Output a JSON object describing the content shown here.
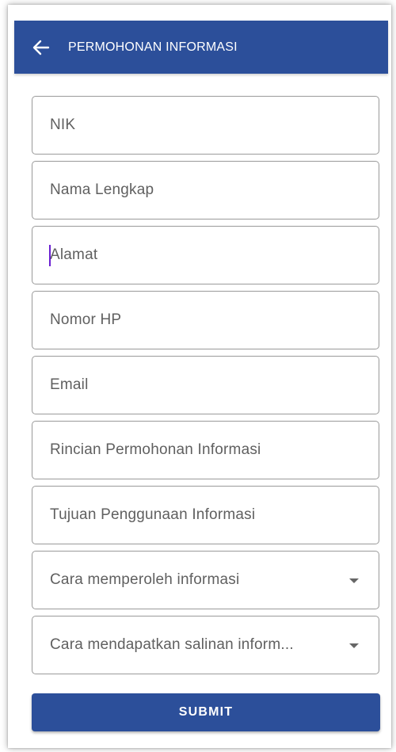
{
  "header": {
    "title": "PERMOHONAN INFORMASI",
    "back_icon": "arrow-left-icon",
    "color": "#2c4f9a"
  },
  "form": {
    "nik": {
      "placeholder": "NIK",
      "value": ""
    },
    "nama": {
      "placeholder": "Nama Lengkap",
      "value": ""
    },
    "alamat": {
      "placeholder": "Alamat",
      "value": ""
    },
    "nomor_hp": {
      "placeholder": "Nomor HP",
      "value": ""
    },
    "email": {
      "placeholder": "Email",
      "value": ""
    },
    "rincian": {
      "placeholder": "Rincian Permohonan Informasi",
      "value": ""
    },
    "tujuan": {
      "placeholder": "Tujuan Penggunaan Informasi",
      "value": ""
    },
    "cara_memperoleh": {
      "label": "Cara memperoleh informasi"
    },
    "cara_salinan": {
      "label": "Cara mendapatkan salinan inform..."
    }
  },
  "submit": {
    "label": "SUBMIT"
  },
  "colors": {
    "accent": "#2c4f9a",
    "caret": "#6a1fd1"
  }
}
